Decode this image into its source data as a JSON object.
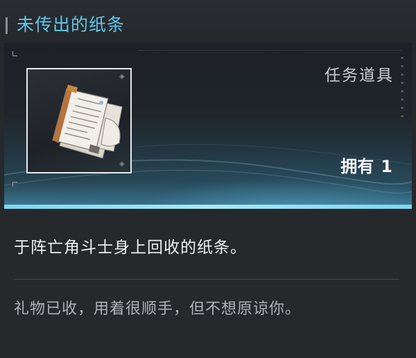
{
  "item": {
    "name": "未传出的纸条",
    "type": "任务道具",
    "owned_label": "拥有",
    "owned_count": "1",
    "description": "于阵亡角斗士身上回收的纸条。",
    "flavor_text": "礼物已收，用着很顺手，但不想原谅你。",
    "icon": "folded-papers-icon"
  },
  "colors": {
    "title": "#5ec8ee",
    "accent_line": "#7fd6ef",
    "background": "#26292c"
  }
}
